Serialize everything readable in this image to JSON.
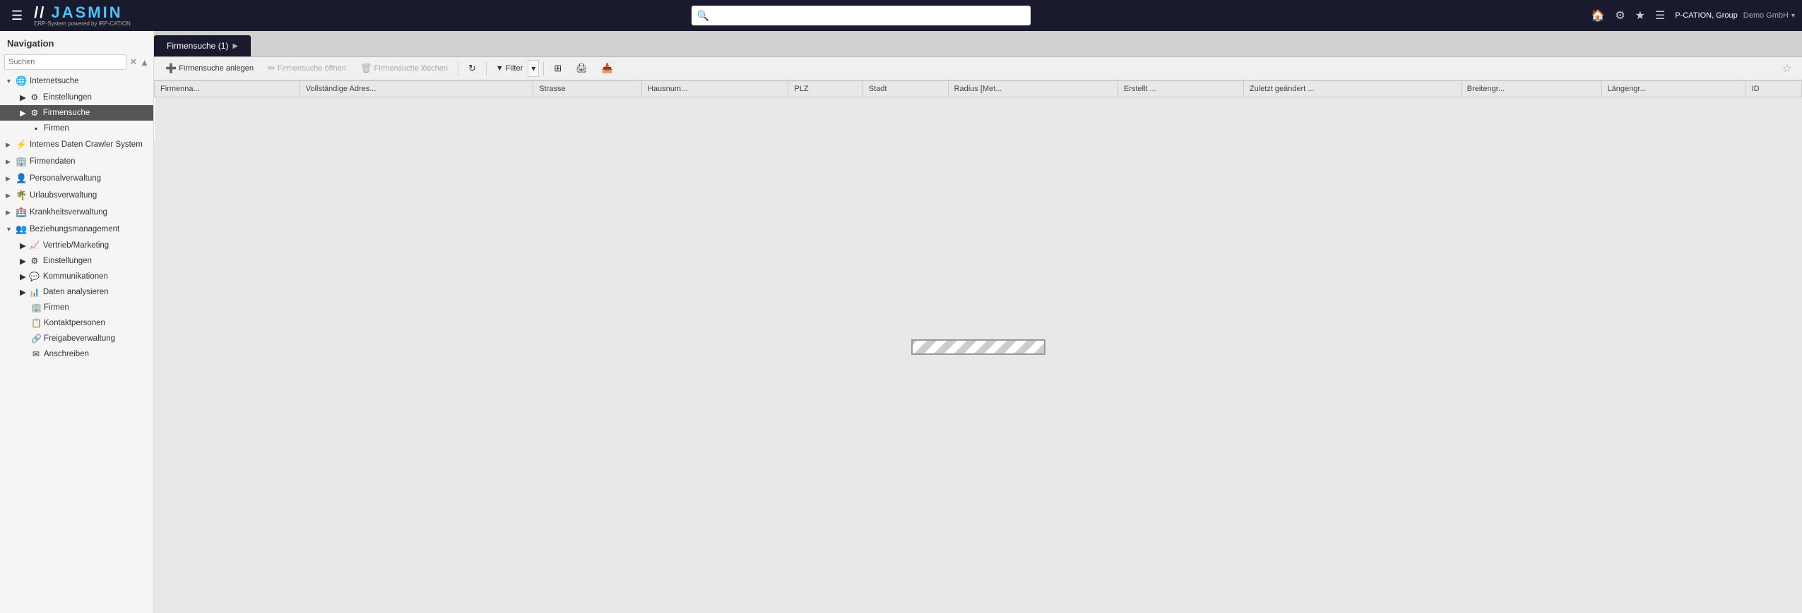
{
  "topbar": {
    "hamburger": "☰",
    "logo_main_prefix": "//",
    "logo_main": "JASMIN",
    "logo_sub": "ERP-System powered by iRP-CATION",
    "search_placeholder": "",
    "icons": {
      "home": "🏠",
      "settings": "⚙",
      "star": "★",
      "list": "☰"
    },
    "user_label": "P-CATION, Group",
    "user_sub": "Demo GmbH",
    "chevron": "▾"
  },
  "sidebar": {
    "title": "Navigation",
    "search_placeholder": "Suchen",
    "clear_icon": "✕",
    "toggle_icon": "▲",
    "items": [
      {
        "id": "internetsuche",
        "label": "Internetsuche",
        "icon": "🌐",
        "type": "group",
        "expanded": true
      },
      {
        "id": "einstellungen-sub",
        "label": "Einstellungen",
        "icon": "⚙",
        "type": "child",
        "indent": 1
      },
      {
        "id": "firmensuche",
        "label": "Firmensuche",
        "icon": "⚙",
        "type": "child",
        "indent": 1,
        "active": true
      },
      {
        "id": "firmen-sub",
        "label": "Firmen",
        "icon": "▪",
        "type": "leaf",
        "indent": 2
      },
      {
        "id": "internes-daten",
        "label": "Internes Daten Crawler System",
        "icon": "⚡",
        "type": "group",
        "expanded": false
      },
      {
        "id": "firmendaten",
        "label": "Firmendaten",
        "icon": "🏢",
        "type": "group",
        "expanded": false
      },
      {
        "id": "personalverwaltung",
        "label": "Personalverwaltung",
        "icon": "👤",
        "type": "group",
        "expanded": false
      },
      {
        "id": "urlaubsverwaltung",
        "label": "Urlaubsverwaltung",
        "icon": "🌴",
        "type": "group",
        "expanded": false
      },
      {
        "id": "krankheitsverwaltung",
        "label": "Krankheitsverwaltung",
        "icon": "🏥",
        "type": "group",
        "expanded": false
      },
      {
        "id": "beziehungsmanagement",
        "label": "Beziehungsmanagement",
        "icon": "👥",
        "type": "group",
        "expanded": true
      },
      {
        "id": "vertrieb",
        "label": "Vertrieb/Marketing",
        "icon": "📈",
        "type": "child",
        "indent": 1
      },
      {
        "id": "einstellungen2",
        "label": "Einstellungen",
        "icon": "⚙",
        "type": "child",
        "indent": 1
      },
      {
        "id": "kommunikationen",
        "label": "Kommunikationen",
        "icon": "💬",
        "type": "child",
        "indent": 1
      },
      {
        "id": "daten-analysieren",
        "label": "Daten analysieren",
        "icon": "📊",
        "type": "child",
        "indent": 1
      },
      {
        "id": "firmen2",
        "label": "Firmen",
        "icon": "🏢",
        "type": "leaf2",
        "indent": 2
      },
      {
        "id": "kontaktpersonen",
        "label": "Kontaktpersonen",
        "icon": "📋",
        "type": "leaf2",
        "indent": 2
      },
      {
        "id": "freigabeverwaltung",
        "label": "Freigabeverwaltung",
        "icon": "🔗",
        "type": "leaf2",
        "indent": 2
      },
      {
        "id": "anschreiben",
        "label": "Anschreiben",
        "icon": "✉",
        "type": "leaf2",
        "indent": 2
      }
    ]
  },
  "tabs": [
    {
      "id": "firmensuche",
      "label": "Firmensuche (1)",
      "active": true
    }
  ],
  "toolbar": {
    "buttons": [
      {
        "id": "anlegen",
        "label": "Firmensuche anlegen",
        "icon": "➕",
        "enabled": true
      },
      {
        "id": "oeffnen",
        "label": "Firmensuche öffnen",
        "icon": "✏",
        "enabled": false
      },
      {
        "id": "loeschen",
        "label": "Firmensuche löschen",
        "icon": "🗑",
        "enabled": false
      },
      {
        "id": "refresh",
        "label": "",
        "icon": "↻",
        "enabled": true
      },
      {
        "id": "filter",
        "label": "Filter",
        "icon": "▼",
        "enabled": true
      },
      {
        "id": "grid",
        "label": "",
        "icon": "⊞",
        "enabled": true
      },
      {
        "id": "print",
        "label": "",
        "icon": "🖨",
        "enabled": true
      },
      {
        "id": "export",
        "label": "",
        "icon": "📥",
        "enabled": true
      }
    ]
  },
  "table": {
    "columns": [
      "Firmenna...",
      "Vollständige Adres...",
      "Strasse",
      "Hausnum...",
      "PLZ",
      "Stadt",
      "Radius [Met...",
      "Erstellt ...",
      "Zuletzt geändert ...",
      "Breitengr...",
      "Längengr...",
      "ID"
    ],
    "rows": []
  },
  "loading": {
    "visible": true
  }
}
